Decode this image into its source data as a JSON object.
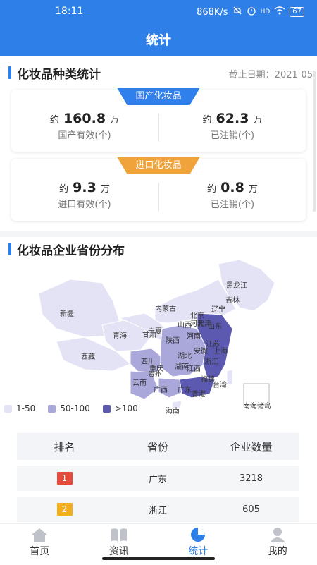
{
  "status_bar": {
    "time": "18:11",
    "speed": "868K/s",
    "signal": "HD",
    "battery": "67"
  },
  "title": "统计",
  "section1": {
    "title": "化妆品种类统计",
    "date": "截止日期：2021-05"
  },
  "domestic": {
    "tag": "国产化妆品",
    "tag_color": "#2f80ed",
    "left": {
      "prefix": "约",
      "value": "160.8",
      "unit": "万",
      "label": "国产有效(个)"
    },
    "right": {
      "prefix": "约",
      "value": "62.3",
      "unit": "万",
      "label": "已注销(个)"
    }
  },
  "imported": {
    "tag": "进口化妆品",
    "tag_color": "#f0a23b",
    "left": {
      "prefix": "约",
      "value": "9.3",
      "unit": "万",
      "label": "进口有效(个)"
    },
    "right": {
      "prefix": "约",
      "value": "0.8",
      "unit": "万",
      "label": "已注销(个)"
    }
  },
  "section2": {
    "title": "化妆品企业省份分布"
  },
  "map": {
    "provinces": [
      "黑龙江",
      "吉林",
      "辽宁",
      "内蒙古",
      "北京",
      "天津",
      "河北",
      "山西",
      "宁夏",
      "甘肃",
      "青海",
      "新疆",
      "西藏",
      "四川",
      "重庆",
      "陕西",
      "河南",
      "山东",
      "江苏",
      "安徽",
      "湖北",
      "湖南",
      "江西",
      "浙江",
      "上海",
      "福建",
      "贵州",
      "云南",
      "广西",
      "广东",
      "香港",
      "台湾",
      "海南",
      "南海诸岛"
    ],
    "colors": {
      "low": "#e3e3f5",
      "mid": "#aaa7db",
      "high": "#5b59b0"
    }
  },
  "legend": [
    "1-50",
    "50-100",
    ">100"
  ],
  "table": {
    "headers": [
      "排名",
      "省份",
      "企业数量"
    ],
    "rows": [
      {
        "rank": "1",
        "province": "广东",
        "count": "3218",
        "color": "#e54a3a"
      },
      {
        "rank": "2",
        "province": "浙江",
        "count": "605",
        "color": "#f2b01e"
      }
    ]
  },
  "tabs": [
    {
      "label": "首页",
      "icon": "home-icon"
    },
    {
      "label": "资讯",
      "icon": "book-icon"
    },
    {
      "label": "统计",
      "icon": "pie-chart-icon"
    },
    {
      "label": "我的",
      "icon": "user-icon"
    }
  ]
}
